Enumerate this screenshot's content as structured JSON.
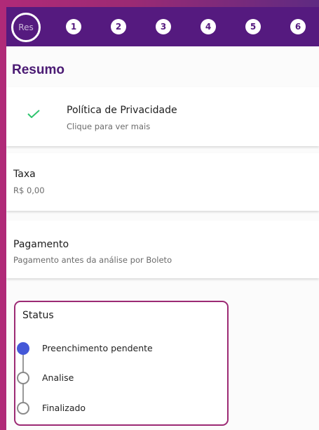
{
  "stepper": {
    "current_label": "Res",
    "steps": [
      "1",
      "2",
      "3",
      "4",
      "5",
      "6"
    ]
  },
  "page": {
    "title": "Resumo"
  },
  "privacy": {
    "title": "Política de Privacidade",
    "subtitle": "Clique para ver mais",
    "icon": "check-icon"
  },
  "fee": {
    "title": "Taxa",
    "value": "R$ 0,00"
  },
  "payment": {
    "title": "Pagamento",
    "value": "Pagamento antes da análise por Boleto"
  },
  "status": {
    "title": "Status",
    "items": [
      {
        "label": "Preenchimento pendente",
        "active": true
      },
      {
        "label": "Analise",
        "active": false
      },
      {
        "label": "Finalizado",
        "active": false
      }
    ]
  },
  "colors": {
    "header": "#551a7f",
    "accent": "#9c2a74",
    "check": "#2fc46e",
    "active_dot": "#4458d8"
  }
}
